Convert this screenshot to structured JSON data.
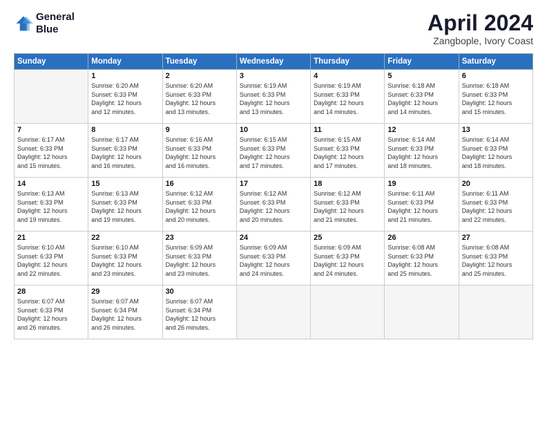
{
  "header": {
    "logo_line1": "General",
    "logo_line2": "Blue",
    "month": "April 2024",
    "location": "Zangbople, Ivory Coast"
  },
  "days_of_week": [
    "Sunday",
    "Monday",
    "Tuesday",
    "Wednesday",
    "Thursday",
    "Friday",
    "Saturday"
  ],
  "weeks": [
    [
      {
        "day": "",
        "lines": []
      },
      {
        "day": "1",
        "lines": [
          "Sunrise: 6:20 AM",
          "Sunset: 6:33 PM",
          "Daylight: 12 hours",
          "and 12 minutes."
        ]
      },
      {
        "day": "2",
        "lines": [
          "Sunrise: 6:20 AM",
          "Sunset: 6:33 PM",
          "Daylight: 12 hours",
          "and 13 minutes."
        ]
      },
      {
        "day": "3",
        "lines": [
          "Sunrise: 6:19 AM",
          "Sunset: 6:33 PM",
          "Daylight: 12 hours",
          "and 13 minutes."
        ]
      },
      {
        "day": "4",
        "lines": [
          "Sunrise: 6:19 AM",
          "Sunset: 6:33 PM",
          "Daylight: 12 hours",
          "and 14 minutes."
        ]
      },
      {
        "day": "5",
        "lines": [
          "Sunrise: 6:18 AM",
          "Sunset: 6:33 PM",
          "Daylight: 12 hours",
          "and 14 minutes."
        ]
      },
      {
        "day": "6",
        "lines": [
          "Sunrise: 6:18 AM",
          "Sunset: 6:33 PM",
          "Daylight: 12 hours",
          "and 15 minutes."
        ]
      }
    ],
    [
      {
        "day": "7",
        "lines": [
          "Sunrise: 6:17 AM",
          "Sunset: 6:33 PM",
          "Daylight: 12 hours",
          "and 15 minutes."
        ]
      },
      {
        "day": "8",
        "lines": [
          "Sunrise: 6:17 AM",
          "Sunset: 6:33 PM",
          "Daylight: 12 hours",
          "and 16 minutes."
        ]
      },
      {
        "day": "9",
        "lines": [
          "Sunrise: 6:16 AM",
          "Sunset: 6:33 PM",
          "Daylight: 12 hours",
          "and 16 minutes."
        ]
      },
      {
        "day": "10",
        "lines": [
          "Sunrise: 6:15 AM",
          "Sunset: 6:33 PM",
          "Daylight: 12 hours",
          "and 17 minutes."
        ]
      },
      {
        "day": "11",
        "lines": [
          "Sunrise: 6:15 AM",
          "Sunset: 6:33 PM",
          "Daylight: 12 hours",
          "and 17 minutes."
        ]
      },
      {
        "day": "12",
        "lines": [
          "Sunrise: 6:14 AM",
          "Sunset: 6:33 PM",
          "Daylight: 12 hours",
          "and 18 minutes."
        ]
      },
      {
        "day": "13",
        "lines": [
          "Sunrise: 6:14 AM",
          "Sunset: 6:33 PM",
          "Daylight: 12 hours",
          "and 18 minutes."
        ]
      }
    ],
    [
      {
        "day": "14",
        "lines": [
          "Sunrise: 6:13 AM",
          "Sunset: 6:33 PM",
          "Daylight: 12 hours",
          "and 19 minutes."
        ]
      },
      {
        "day": "15",
        "lines": [
          "Sunrise: 6:13 AM",
          "Sunset: 6:33 PM",
          "Daylight: 12 hours",
          "and 19 minutes."
        ]
      },
      {
        "day": "16",
        "lines": [
          "Sunrise: 6:12 AM",
          "Sunset: 6:33 PM",
          "Daylight: 12 hours",
          "and 20 minutes."
        ]
      },
      {
        "day": "17",
        "lines": [
          "Sunrise: 6:12 AM",
          "Sunset: 6:33 PM",
          "Daylight: 12 hours",
          "and 20 minutes."
        ]
      },
      {
        "day": "18",
        "lines": [
          "Sunrise: 6:12 AM",
          "Sunset: 6:33 PM",
          "Daylight: 12 hours",
          "and 21 minutes."
        ]
      },
      {
        "day": "19",
        "lines": [
          "Sunrise: 6:11 AM",
          "Sunset: 6:33 PM",
          "Daylight: 12 hours",
          "and 21 minutes."
        ]
      },
      {
        "day": "20",
        "lines": [
          "Sunrise: 6:11 AM",
          "Sunset: 6:33 PM",
          "Daylight: 12 hours",
          "and 22 minutes."
        ]
      }
    ],
    [
      {
        "day": "21",
        "lines": [
          "Sunrise: 6:10 AM",
          "Sunset: 6:33 PM",
          "Daylight: 12 hours",
          "and 22 minutes."
        ]
      },
      {
        "day": "22",
        "lines": [
          "Sunrise: 6:10 AM",
          "Sunset: 6:33 PM",
          "Daylight: 12 hours",
          "and 23 minutes."
        ]
      },
      {
        "day": "23",
        "lines": [
          "Sunrise: 6:09 AM",
          "Sunset: 6:33 PM",
          "Daylight: 12 hours",
          "and 23 minutes."
        ]
      },
      {
        "day": "24",
        "lines": [
          "Sunrise: 6:09 AM",
          "Sunset: 6:33 PM",
          "Daylight: 12 hours",
          "and 24 minutes."
        ]
      },
      {
        "day": "25",
        "lines": [
          "Sunrise: 6:09 AM",
          "Sunset: 6:33 PM",
          "Daylight: 12 hours",
          "and 24 minutes."
        ]
      },
      {
        "day": "26",
        "lines": [
          "Sunrise: 6:08 AM",
          "Sunset: 6:33 PM",
          "Daylight: 12 hours",
          "and 25 minutes."
        ]
      },
      {
        "day": "27",
        "lines": [
          "Sunrise: 6:08 AM",
          "Sunset: 6:33 PM",
          "Daylight: 12 hours",
          "and 25 minutes."
        ]
      }
    ],
    [
      {
        "day": "28",
        "lines": [
          "Sunrise: 6:07 AM",
          "Sunset: 6:33 PM",
          "Daylight: 12 hours",
          "and 26 minutes."
        ]
      },
      {
        "day": "29",
        "lines": [
          "Sunrise: 6:07 AM",
          "Sunset: 6:34 PM",
          "Daylight: 12 hours",
          "and 26 minutes."
        ]
      },
      {
        "day": "30",
        "lines": [
          "Sunrise: 6:07 AM",
          "Sunset: 6:34 PM",
          "Daylight: 12 hours",
          "and 26 minutes."
        ]
      },
      {
        "day": "",
        "lines": []
      },
      {
        "day": "",
        "lines": []
      },
      {
        "day": "",
        "lines": []
      },
      {
        "day": "",
        "lines": []
      }
    ]
  ]
}
